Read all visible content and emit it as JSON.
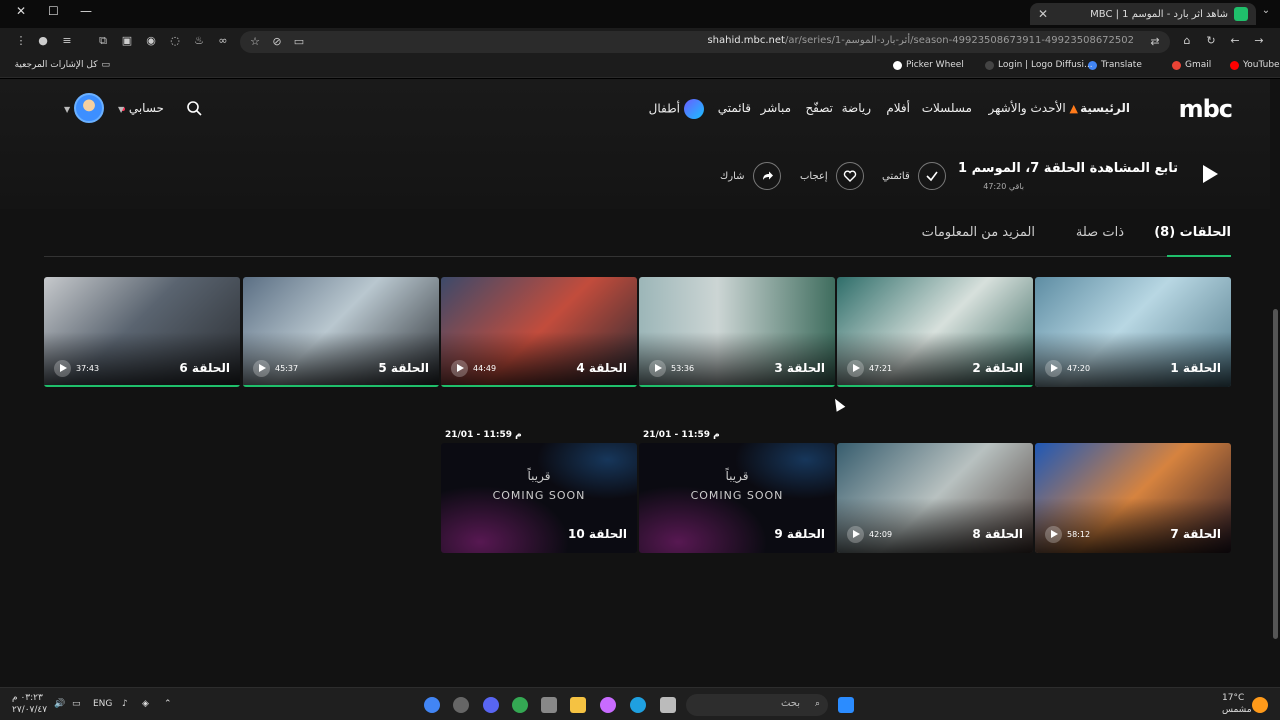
{
  "browser": {
    "tab_title": "شاهد أثر بارد - الموسم 1 | MBC",
    "url_host": "shahid.mbc.net",
    "url_path": "/ar/series/1-أثر-بارد-الموسم/season-49923508673911-49923508672502",
    "bookmarks_all": "كل الإشارات المرجعية",
    "bookmarks": [
      "Picker Wheel",
      "Login | Logo Diffusi...",
      "Translate",
      "Gmail",
      "YouTube"
    ]
  },
  "nav": {
    "logo": "mbc",
    "items": [
      "الرئيسية",
      "الأحدث والأشهر",
      "مسلسلات",
      "أفلام",
      "رياضة",
      "تصفّح",
      "مباشر",
      "قائمتي",
      "أطفال"
    ],
    "account": "حسابي"
  },
  "continue": {
    "title": "تابع المشاهدة الحلقة 7، الموسم 1",
    "remaining": "47:20 باقي",
    "actions": {
      "mylist": "قائمتي",
      "like": "إعجاب",
      "share": "شارك"
    }
  },
  "tabs": {
    "episodes": "الحلقات (8)",
    "related": "ذات صلة",
    "more_info": "المزيد من المعلومات"
  },
  "episodes": [
    {
      "title": "الحلقة 1",
      "duration": "47:20"
    },
    {
      "title": "الحلقة 2",
      "duration": "47:21"
    },
    {
      "title": "الحلقة 3",
      "duration": "53:36"
    },
    {
      "title": "الحلقة 4",
      "duration": "44:49"
    },
    {
      "title": "الحلقة 5",
      "duration": "45:37"
    },
    {
      "title": "الحلقة 6",
      "duration": "37:43"
    },
    {
      "title": "الحلقة 7",
      "duration": "58:12"
    },
    {
      "title": "الحلقة 8",
      "duration": "42:09"
    },
    {
      "title": "الحلقة 9",
      "soon_ar": "قريباً",
      "soon_en": "COMING SOON",
      "date": "21/01 - 11:59 م"
    },
    {
      "title": "الحلقة 10",
      "soon_ar": "قريباً",
      "soon_en": "COMING SOON",
      "date": "21/01 - 11:59 م"
    }
  ],
  "taskbar": {
    "search": "بحث",
    "weather_temp": "17°C",
    "weather_desc": "مشمس",
    "lang": "ENG",
    "time": "٠٣:٢٣ م",
    "date": "٢٧/٠٧/٤٧"
  }
}
